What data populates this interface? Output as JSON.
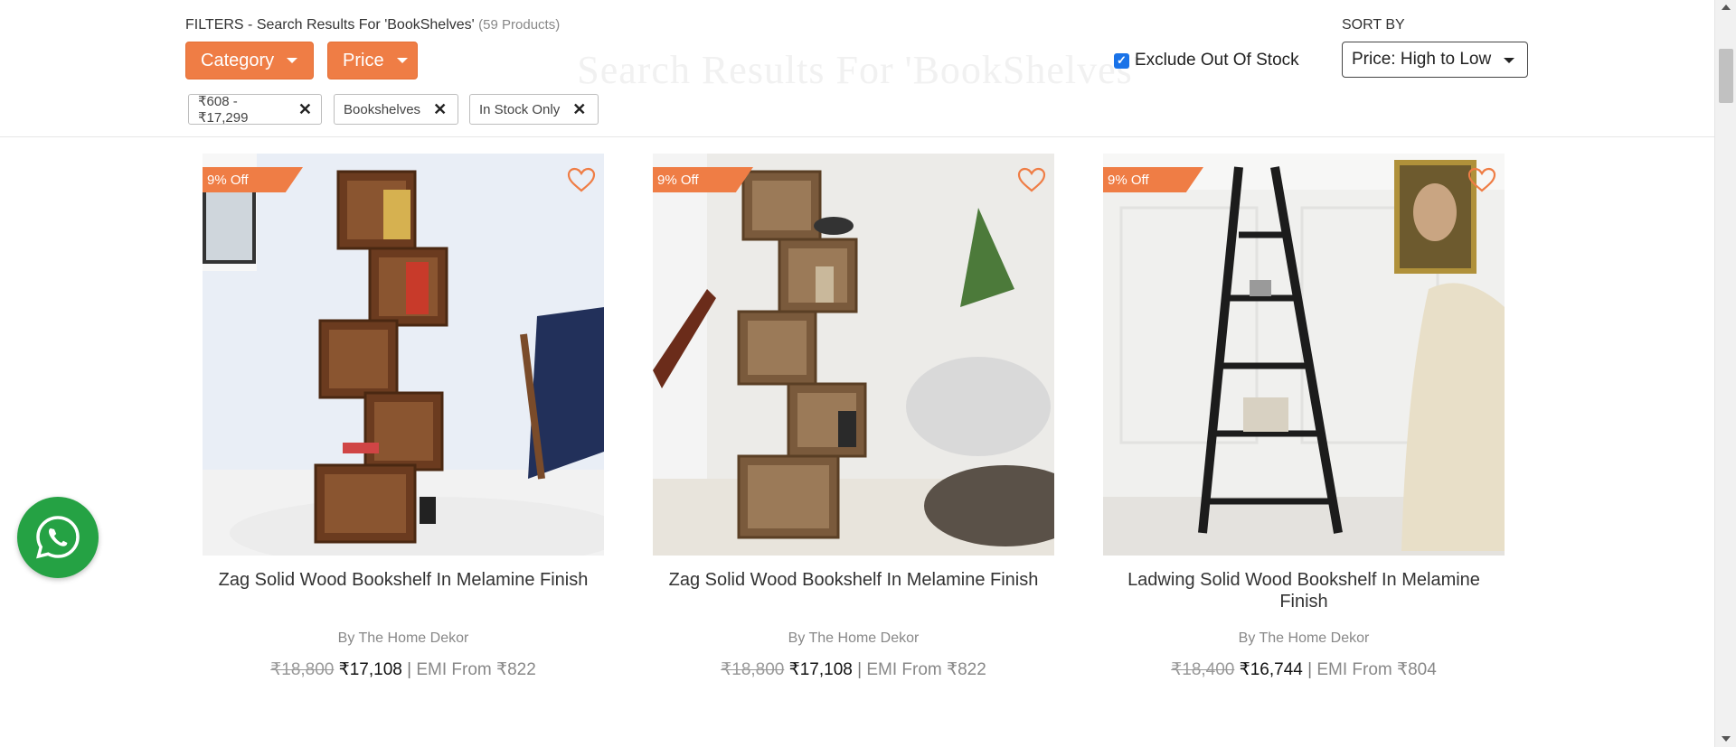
{
  "ghost_heading": "Search Results For 'BookShelves'",
  "filters": {
    "title": "FILTERS - Search Results For 'BookShelves'",
    "count": "(59 Products)",
    "category_label": "Category",
    "price_label": "Price",
    "chips": [
      {
        "label": "₹608 - ₹17,299"
      },
      {
        "label": "Bookshelves"
      },
      {
        "label": "In Stock Only"
      }
    ],
    "exclude_out_of_stock": {
      "label": "Exclude Out Of Stock",
      "checked": true
    }
  },
  "sort": {
    "label": "SORT BY",
    "selected": "Price: High to Low"
  },
  "products": [
    {
      "badge": "9% Off",
      "name": "Zag Solid Wood Bookshelf In Melamine Finish",
      "brand": "By The Home Dekor",
      "mrp": "₹18,800",
      "price": "₹17,108",
      "emi": "EMI From ₹822"
    },
    {
      "badge": "9% Off",
      "name": "Zag Solid Wood Bookshelf In Melamine Finish",
      "brand": "By The Home Dekor",
      "mrp": "₹18,800",
      "price": "₹17,108",
      "emi": "EMI From ₹822"
    },
    {
      "badge": "9% Off",
      "name": "Ladwing Solid Wood Bookshelf In Melamine Finish",
      "brand": "By The Home Dekor",
      "mrp": "₹18,400",
      "price": "₹16,744",
      "emi": "EMI From ₹804"
    }
  ],
  "colors": {
    "accent": "#ef7d45",
    "whatsapp": "#25a244",
    "checkbox": "#1a73e8"
  },
  "icons": {
    "wishlist": "heart-outline-icon",
    "chip_remove": "close-icon",
    "dropdown": "caret-down-icon",
    "chat": "whatsapp-icon"
  }
}
